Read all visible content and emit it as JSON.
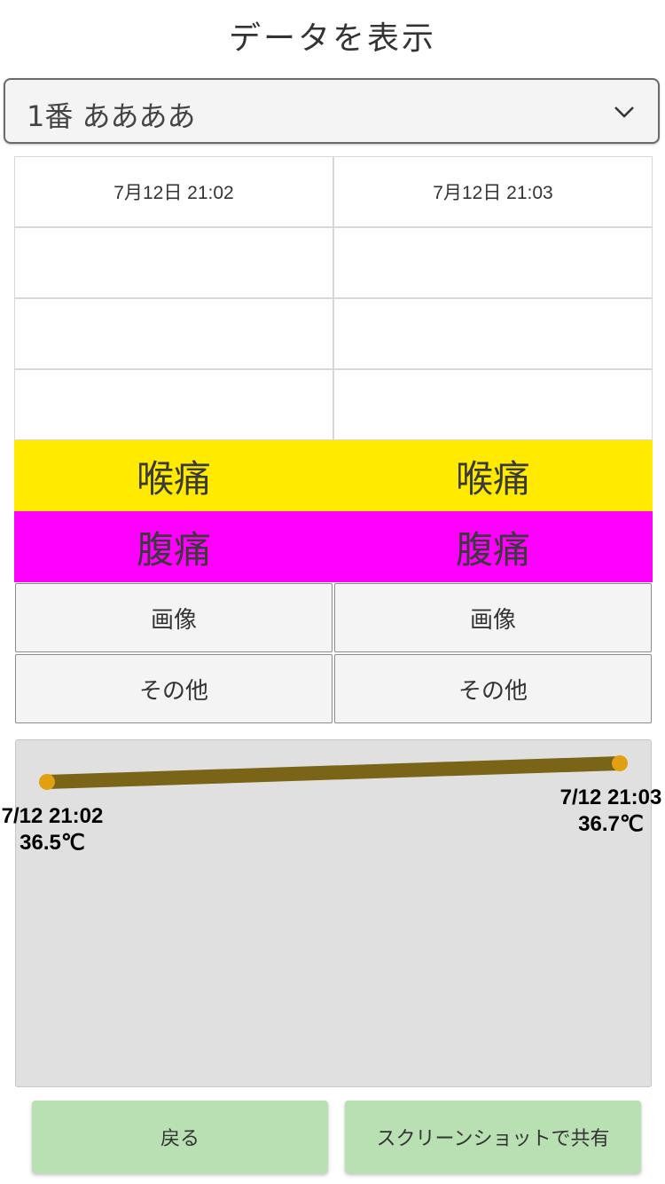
{
  "header": {
    "title": "データを表示"
  },
  "person_select": {
    "value": "1番 ああああ"
  },
  "table": {
    "columns": [
      {
        "date": "7月12日 21:02",
        "row2": "",
        "row3": "",
        "row4": "",
        "symptom1": "喉痛",
        "symptom2": "腹痛",
        "image_button": "画像",
        "other_button": "その他"
      },
      {
        "date": "7月12日 21:03",
        "row2": "",
        "row3": "",
        "row4": "",
        "symptom1": "喉痛",
        "symptom2": "腹痛",
        "image_button": "画像",
        "other_button": "その他"
      }
    ],
    "symptom_colors": {
      "symptom1": "#ffea00",
      "symptom2": "#ff00ff"
    }
  },
  "chart_data": {
    "type": "line",
    "x": [
      "7/12 21:02",
      "7/12 21:03"
    ],
    "series": [
      {
        "values": [
          36.5,
          36.7
        ]
      }
    ],
    "point_labels": [
      {
        "date": "7/12 21:02",
        "temp": "36.5℃"
      },
      {
        "date": "7/12 21:03",
        "temp": "36.7℃"
      }
    ],
    "line_color": "#7a6418",
    "point_color": "#e0a010",
    "background": "#e0e0e0"
  },
  "footer": {
    "back_label": "戻る",
    "share_label": "スクリーンショットで共有",
    "button_color": "#b9e0b3"
  }
}
